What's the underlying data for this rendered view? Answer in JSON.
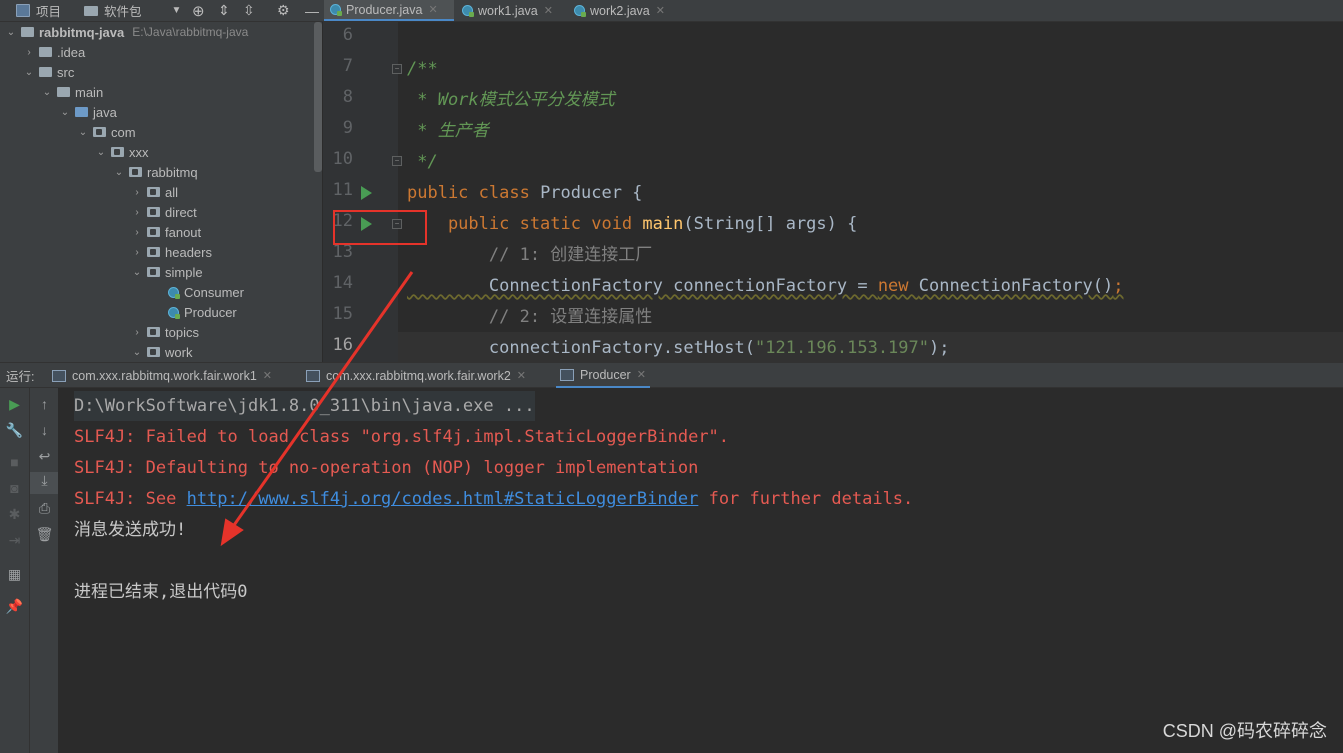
{
  "topbar": {
    "project_label": "项目",
    "packages_label": "软件包",
    "tabs": [
      {
        "label": "Producer.java"
      },
      {
        "label": "work1.java"
      },
      {
        "label": "work2.java"
      }
    ]
  },
  "tree": {
    "root": {
      "label": "rabbitmq-java",
      "path": "E:\\Java\\rabbitmq-java"
    },
    "idea": ".idea",
    "src": "src",
    "main": "main",
    "java": "java",
    "com": "com",
    "xxx": "xxx",
    "rabbitmq": "rabbitmq",
    "folders": [
      "all",
      "direct",
      "fanout",
      "headers"
    ],
    "simple": "simple",
    "simple_classes": [
      "Consumer",
      "Producer"
    ],
    "topics": "topics",
    "work": "work"
  },
  "editor": {
    "line_numbers": [
      "6",
      "7",
      "8",
      "9",
      "10",
      "11",
      "12",
      "13",
      "14",
      "15",
      "16"
    ],
    "lines": {
      "l7": "/**",
      "l8": " * Work模式公平分发模式",
      "l9": " * 生产者",
      "l10": " */",
      "l11_kw": "public class ",
      "l11_name": "Producer {",
      "l12_kw": "    public static void ",
      "l12_fn": "main",
      "l12_rest": "(String[] args) {",
      "l13": "        // 1: 创建连接工厂",
      "l14_type": "        ConnectionFactory connectionFactory = ",
      "l14_new": "new ",
      "l14_rest": "ConnectionFactory()",
      "l14_semi": ";",
      "l15": "        // 2: 设置连接属性",
      "l16_pre": "        connectionFactory.setHost(",
      "l16_str": "\"121.196.153.197\"",
      "l16_post": ");"
    }
  },
  "runbar": {
    "label": "运行:",
    "tabs": [
      {
        "label": "com.xxx.rabbitmq.work.fair.work1"
      },
      {
        "label": "com.xxx.rabbitmq.work.fair.work2"
      },
      {
        "label": "Producer"
      }
    ]
  },
  "console": {
    "cmd": "D:\\WorkSoftware\\jdk1.8.0_311\\bin\\java.exe ...",
    "err1": "SLF4J: Failed to load class \"org.slf4j.impl.StaticLoggerBinder\".",
    "err2": "SLF4J: Defaulting to no-operation (NOP) logger implementation",
    "err3_pre": "SLF4J: See ",
    "err3_link": "http://www.slf4j.org/codes.html#StaticLoggerBinder",
    "err3_post": " for further details.",
    "out1": "消息发送成功!",
    "out2": "进程已结束,退出代码0"
  },
  "watermark": "CSDN @码农碎碎念",
  "colors": {
    "accent": "#4a88c7",
    "error": "#e55a52",
    "annotation": "#e5332a",
    "run_green": "#499c54"
  }
}
